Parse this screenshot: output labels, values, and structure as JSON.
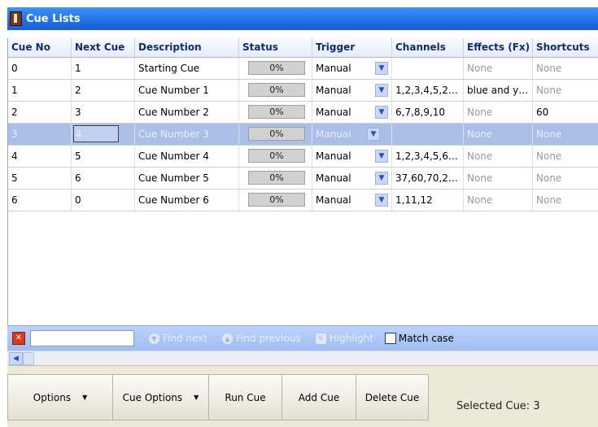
{
  "window": {
    "title": "Cue Lists"
  },
  "columns": [
    "Cue No",
    "Next Cue",
    "Description",
    "Status",
    "Trigger",
    "Channels",
    "Effects (Fx)",
    "Shortcuts"
  ],
  "rows": [
    {
      "cue": "0",
      "next": "1",
      "desc": "Starting Cue",
      "status": "0%",
      "trigger": "Manual",
      "channels": "",
      "fx": "None",
      "shortcuts": "None"
    },
    {
      "cue": "1",
      "next": "2",
      "desc": "Cue Number 1",
      "status": "0%",
      "trigger": "Manual",
      "channels": "1,2,3,4,5,2…",
      "fx": "blue and y…",
      "shortcuts": "None"
    },
    {
      "cue": "2",
      "next": "3",
      "desc": "Cue Number 2",
      "status": "0%",
      "trigger": "Manual",
      "channels": "6,7,8,9,10",
      "fx": "None",
      "shortcuts": "60"
    },
    {
      "cue": "3",
      "next": "4",
      "desc": "Cue Number 3",
      "status": "0%",
      "trigger": "Manual",
      "channels": "",
      "fx": "None",
      "shortcuts": "None"
    },
    {
      "cue": "4",
      "next": "5",
      "desc": "Cue Number 4",
      "status": "0%",
      "trigger": "Manual",
      "channels": "1,2,3,4,5,6…",
      "fx": "None",
      "shortcuts": "None"
    },
    {
      "cue": "5",
      "next": "6",
      "desc": "Cue Number 5",
      "status": "0%",
      "trigger": "Manual",
      "channels": "37,60,70,2…",
      "fx": "None",
      "shortcuts": "None"
    },
    {
      "cue": "6",
      "next": "0",
      "desc": "Cue Number 6",
      "status": "0%",
      "trigger": "Manual",
      "channels": "1,11,12",
      "fx": "None",
      "shortcuts": "None"
    }
  ],
  "selected_row": "3",
  "findbar": {
    "value": "",
    "find_next": "Find next",
    "find_previous": "Find previous",
    "highlight": "Highlight",
    "match_case": "Match case"
  },
  "toolbar": {
    "options": "Options",
    "cue_options": "Cue Options",
    "run_cue": "Run Cue",
    "add_cue": "Add Cue",
    "delete_cue": "Delete Cue"
  },
  "status": {
    "selected_cue": "Selected Cue: 3"
  },
  "icons": {
    "app": "app-icon",
    "dropdown": "chevron-down-icon",
    "close": "close-icon",
    "find_next": "arrow-down-circle-icon",
    "find_previous": "arrow-up-circle-icon",
    "highlight": "highlight-icon",
    "scroll_left": "chevron-left-icon"
  },
  "colors": {
    "titlebar": "#2a7ff0",
    "selection": "#aabee8",
    "findbar": "#aec8f6",
    "toolbar": "#ece9d8"
  }
}
